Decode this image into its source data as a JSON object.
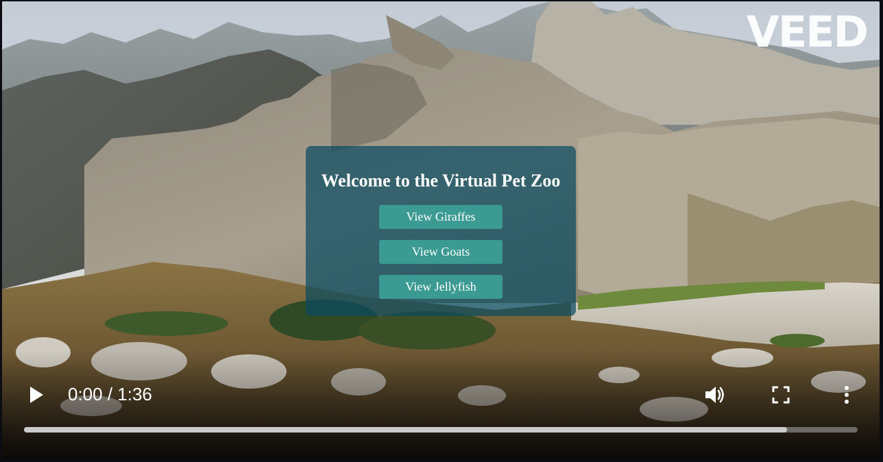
{
  "player": {
    "watermark": "VEED",
    "current_time": "0:00",
    "duration": "1:36",
    "time_separator": " / ",
    "progress_fraction": 0,
    "buffered_fraction": 0.915,
    "icons": [
      "play-icon",
      "volume-icon",
      "fullscreen-icon",
      "more-options-icon"
    ]
  },
  "overlay": {
    "title": "Welcome to the Virtual Pet Zoo",
    "buttons": [
      {
        "label": "View Giraffes"
      },
      {
        "label": "View Goats"
      },
      {
        "label": "View Jellyfish"
      }
    ],
    "panel_color": "#0a4b5f",
    "button_color": "#3b9a92"
  }
}
